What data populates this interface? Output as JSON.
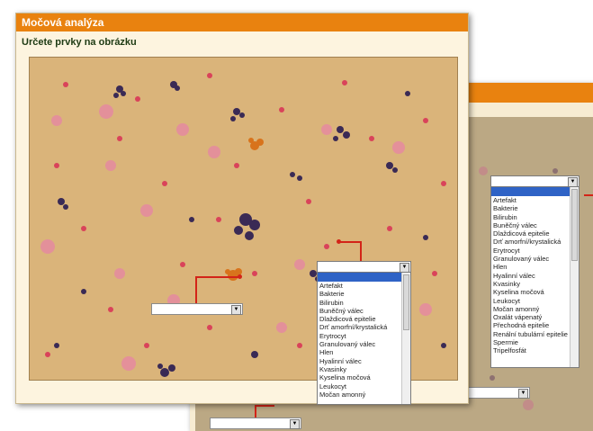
{
  "back_window": {
    "lower_left_select_value": "",
    "lower_right_select_value": "",
    "dropdown": {
      "selected": "",
      "options": [
        "Artefakt",
        "Bakterie",
        "Bilirubin",
        "Buněčný válec",
        "Dlaždicová epitelie",
        "Drť amorfní/krystalická",
        "Erytrocyt",
        "Granulovaný válec",
        "Hlen",
        "Hyalinní válec",
        "Kvasinky",
        "Kyselina močová",
        "Leukocyt",
        "Močan amonný",
        "Oxalát vápenatý",
        "Přechodná epitelie",
        "Renální tubulární epitelie",
        "Spermie",
        "Tripelfosfát"
      ]
    }
  },
  "front_window": {
    "title": "Močová analýza",
    "subtitle": "Určete prvky na obrázku",
    "left_select_value": "",
    "dropdown": {
      "selected": "",
      "options": [
        "Artefakt",
        "Bakterie",
        "Bilirubin",
        "Buněčný válec",
        "Dlaždicová epitelie",
        "Drť amorfní/krystalická",
        "Erytrocyt",
        "Granulovaný válec",
        "Hlen",
        "Hyalinní válec",
        "Kvasinky",
        "Kyselina močová",
        "Leukocyt",
        "Močan amonný"
      ]
    }
  },
  "icons": {
    "dropdown_arrow": "chevron-down-icon"
  },
  "colors": {
    "title_bar": "#e9820f",
    "panel_bg": "#fdf4df",
    "marker": "#d32418",
    "selection": "#2f63c6",
    "microscope_bg": "#dab47a"
  }
}
